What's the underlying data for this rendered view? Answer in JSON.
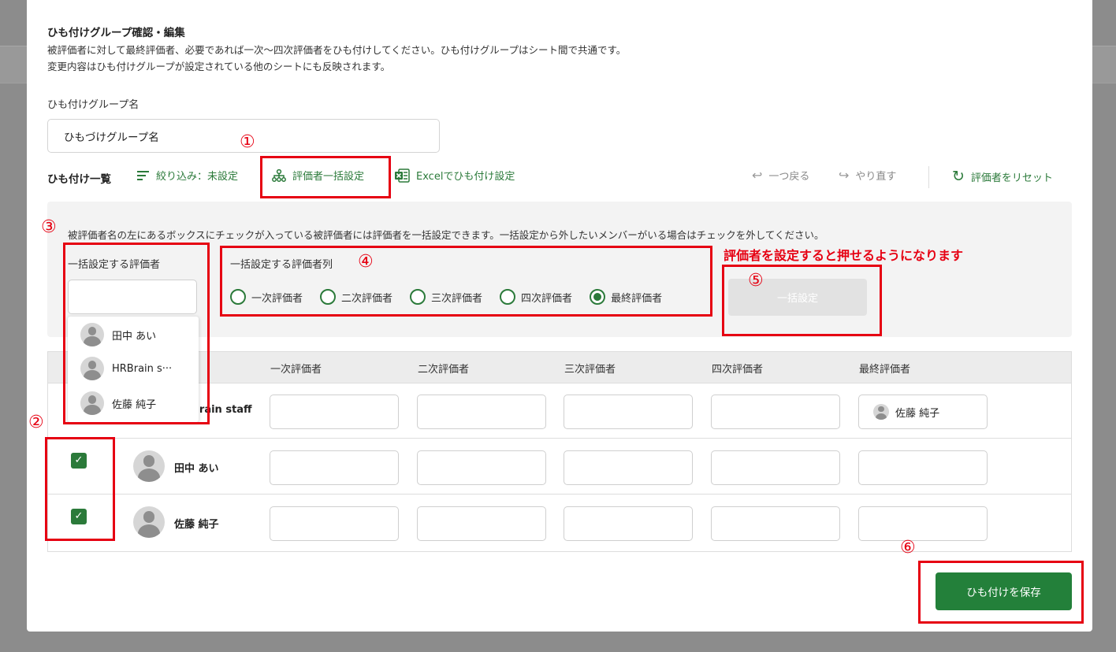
{
  "modal": {
    "title": "ひも付けグループ確認・編集",
    "description_1": "被評価者に対して最終評価者、必要であれば一次〜四次評価者をひも付けしてください。ひも付けグループはシート間で共通です。",
    "description_2": "変更内容はひも付けグループが設定されている他のシートにも反映されます。",
    "group_name_label": "ひも付けグループ名",
    "group_name_value": "ひもづけグループ名"
  },
  "toolbar": {
    "list_title": "ひも付け一覧",
    "filter_label": "絞り込み：未設定",
    "bulk_label": "評価者一括設定",
    "excel_label": "Excelでひも付け設定",
    "undo_label": "一つ戻る",
    "redo_label": "やり直す",
    "reset_label": "評価者をリセット"
  },
  "bulk_panel": {
    "note": "被評価者名の左にあるボックスにチェックが入っている被評価者には評価者を一括設定できます。一括設定から外したいメンバーがいる場合はチェックを外してください。",
    "evaluator_label": "一括設定する評価者",
    "column_label": "一括設定する評価者列",
    "radios": [
      {
        "label": "一次評価者",
        "selected": false
      },
      {
        "label": "二次評価者",
        "selected": false
      },
      {
        "label": "三次評価者",
        "selected": false
      },
      {
        "label": "四次評価者",
        "selected": false
      },
      {
        "label": "最終評価者",
        "selected": true
      }
    ],
    "apply_button": "一括設定"
  },
  "dropdown": {
    "items": [
      "田中 あい",
      "HRBrain s···",
      "佐藤 純子"
    ]
  },
  "table": {
    "headers": [
      "一次評価者",
      "二次評価者",
      "三次評価者",
      "四次評価者",
      "最終評価者"
    ],
    "rows": [
      {
        "name": "HRBrain staff",
        "name_visible": "Brain staff",
        "checked": false,
        "final": "佐藤 純子"
      },
      {
        "name": "田中 あい",
        "checked": true,
        "final": ""
      },
      {
        "name": "佐藤 純子",
        "checked": true,
        "final": ""
      }
    ]
  },
  "footer": {
    "save_button": "ひも付けを保存"
  },
  "annotations": {
    "hint": "評価者を設定すると押せるようになります",
    "numbers": [
      "①",
      "②",
      "③",
      "④",
      "⑤",
      "⑥"
    ],
    "color": "#e60012"
  },
  "colors": {
    "accent": "#2b7a3a",
    "save_button": "#23803a"
  }
}
